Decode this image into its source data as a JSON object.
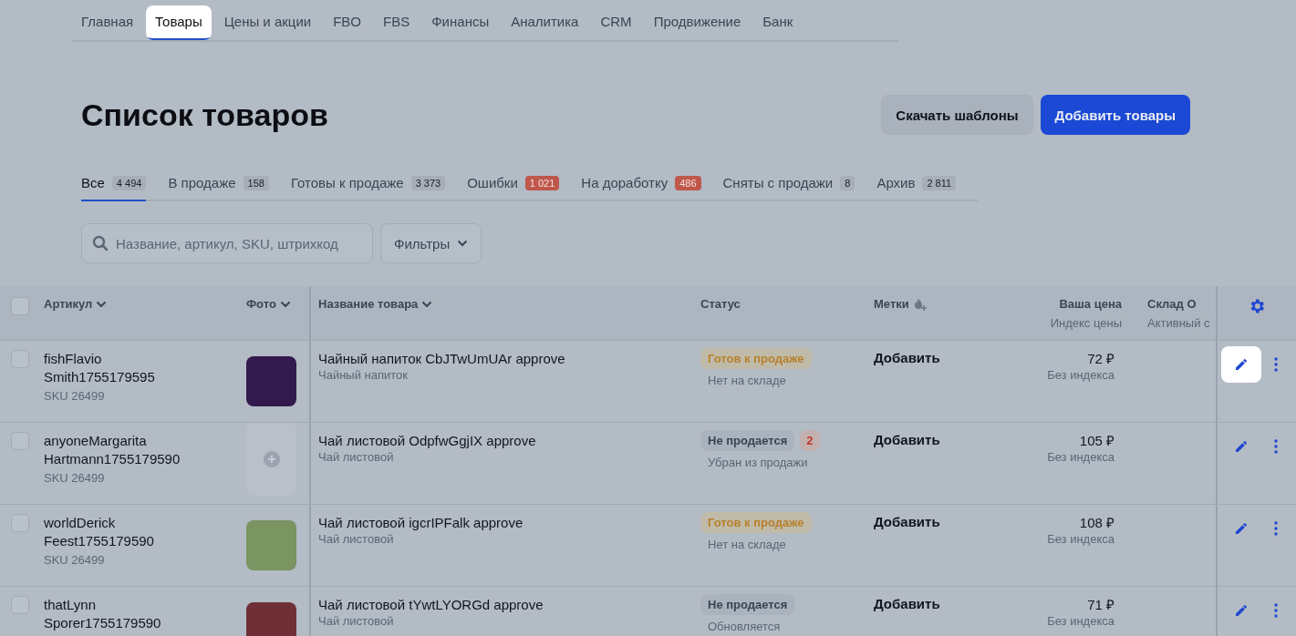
{
  "nav": [
    {
      "label": "Главная",
      "selected": false
    },
    {
      "label": "Товары",
      "selected": true
    },
    {
      "label": "Цены и акции",
      "selected": false
    },
    {
      "label": "FBO",
      "selected": false
    },
    {
      "label": "FBS",
      "selected": false
    },
    {
      "label": "Финансы",
      "selected": false
    },
    {
      "label": "Аналитика",
      "selected": false
    },
    {
      "label": "CRM",
      "selected": false
    },
    {
      "label": "Продвижение",
      "selected": false
    },
    {
      "label": "Банк",
      "selected": false
    }
  ],
  "title": "Список товаров",
  "buttons": [
    {
      "label": "Скачать шаблоны",
      "kind": "secondary"
    },
    {
      "label": "Добавить товары",
      "kind": "primary"
    }
  ],
  "status_tabs": [
    {
      "label": "Все",
      "count": "4 494",
      "kind": "normal",
      "selected": true
    },
    {
      "label": "В продаже",
      "count": "158",
      "kind": "normal",
      "selected": false
    },
    {
      "label": "Готовы к продаже",
      "count": "3 373",
      "kind": "normal",
      "selected": false
    },
    {
      "label": "Ошибки",
      "count": "1 021",
      "kind": "error",
      "selected": false
    },
    {
      "label": "На доработку",
      "count": "486",
      "kind": "error",
      "selected": false
    },
    {
      "label": "Сняты с продажи",
      "count": "8",
      "kind": "normal",
      "selected": false
    },
    {
      "label": "Архив",
      "count": "2 811",
      "kind": "normal",
      "selected": false
    }
  ],
  "search": {
    "placeholder": "Название, артикул, SKU, штрихкод"
  },
  "filters_button": "Фильтры",
  "table": {
    "select_all": {
      "checked": false
    },
    "columns": [
      {
        "label": "Артикул"
      },
      {
        "label": "Фото"
      },
      {
        "label": "Название товара"
      },
      {
        "label": "Статус"
      },
      {
        "label": "Метки"
      },
      {
        "label": "Ваша цена",
        "sub": "Индекс цены"
      },
      {
        "label": "Склад О",
        "sub": "Активный с"
      }
    ],
    "rows": [
      {
        "checked": false,
        "article": "fishFlavio Smith1755179595",
        "sku": "SKU 26499",
        "photo": {
          "kind": "image",
          "color": "#331a4d"
        },
        "name": "Чайный напиток CbJTwUmUAr approve",
        "category": "Чайный напиток",
        "status": {
          "label": "Готов к продаже",
          "kind": "ready"
        },
        "status_note": "Нет на складе",
        "tags": "Добавить",
        "price": "72 ₽",
        "price_index": "Без индекса",
        "edit_highlighted": true
      },
      {
        "checked": false,
        "article": "anyoneMargarita Hartmann1755179590",
        "sku": "SKU 26499",
        "photo": {
          "kind": "empty"
        },
        "name": "Чай листовой OdpfwGgjIX approve",
        "category": "Чай листовой",
        "status": {
          "label": "Не продается",
          "kind": "not_selling",
          "errors": "2"
        },
        "status_note": "Убран из продажи",
        "tags": "Добавить",
        "price": "105 ₽",
        "price_index": "Без индекса",
        "edit_highlighted": false
      },
      {
        "checked": false,
        "article": "worldDerick Feest1755179590",
        "sku": "SKU 26499",
        "photo": {
          "kind": "image",
          "color": "#7a9462"
        },
        "name": "Чай листовой igcrIPFalk approve",
        "category": "Чай листовой",
        "status": {
          "label": "Готов к продаже",
          "kind": "ready"
        },
        "status_note": "Нет на складе",
        "tags": "Добавить",
        "price": "108 ₽",
        "price_index": "Без индекса",
        "edit_highlighted": false
      },
      {
        "checked": false,
        "article": "thatLynn Sporer1755179590",
        "photo": {
          "kind": "image",
          "color": "#6e3036"
        },
        "name": "Чай листовой tYwtLYORGd approve",
        "category": "Чай листовой",
        "status": {
          "label": "Не продается",
          "kind": "not_selling"
        },
        "status_note": "Обновляется",
        "tags": "Добавить",
        "price": "71 ₽",
        "price_index": "Без индекса",
        "edit_highlighted": false
      }
    ]
  }
}
